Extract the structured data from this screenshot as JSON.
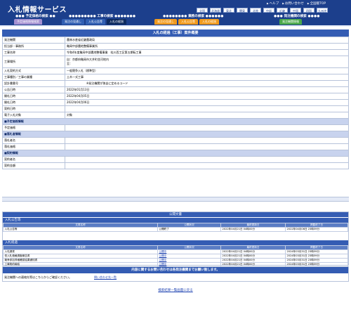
{
  "header": {
    "logo": "入札情報サービス",
    "util": [
      "ヘルプ",
      "お問い合わせ",
      "全国版TOP"
    ],
    "regions": [
      "全国",
      "北海道",
      "東北",
      "関東",
      "北陸",
      "中部",
      "近畿",
      "中国",
      "四国",
      "九州沖縄"
    ],
    "categories": {
      "info": "予定価格の検索",
      "construction": "工事の検索",
      "service": "業務の検索",
      "agency": "発注機関の検索"
    },
    "tabs": [
      "予定価格情報検索",
      "発注の見通し",
      "入札公告等",
      "入札の経過",
      "発注の見通し",
      "入札公告等",
      "入札の経過",
      "発注機関情報"
    ]
  },
  "main": {
    "title": "入札の経過（工事）案件概要",
    "rows": [
      {
        "label": "発注機関",
        "value": "農林水産省近畿農政局"
      },
      {
        "label": "担当部・事務所",
        "value": "亀岡中部農地整備事業所"
      },
      {
        "label": "工事名称",
        "value": "令和4年度亀岡中部農地整備事業　桂川西工区第五期転工事"
      },
      {
        "label": "工事場所",
        "value": "自：京都府亀岡市大井町並河地内",
        "value2": "至："
      },
      {
        "label": "入札契約方式",
        "value": "一般競争入札（標準型）"
      },
      {
        "label": "工事種別／工事の業種",
        "value": "土木一式工事"
      },
      {
        "label": "設計書番号",
        "value": "※発注機関が独自に定めるコード"
      },
      {
        "label": "公告日時",
        "value": "2022年01月13日"
      },
      {
        "label": "開札日時",
        "value": "2022年04月05日"
      },
      {
        "label": "開札日時",
        "value": "2022年04月06日"
      },
      {
        "label": "契約日時",
        "value": ""
      },
      {
        "label": "電子入札対象",
        "value": "対象"
      }
    ],
    "sections": {
      "planned_price": "■予定価格情報",
      "bidder": "■落札者情報",
      "contract": "■契約情報"
    },
    "planned_price_label": "予定価格",
    "bidder_labels": [
      "落札者名",
      "落札価格"
    ],
    "contract_labels": [
      "契約者名",
      "契約金額"
    ]
  },
  "announcements": {
    "title": "公開文書",
    "section1": "入札公告等",
    "section2": "入札経過",
    "headers": [
      "文書名称",
      "公開状況",
      "最終更新日",
      "掲載終了日"
    ],
    "public_rows": [
      {
        "name": "入札公告等",
        "status": "公開終了",
        "updated": "2022年04月21日 04時00分",
        "end": "2022年04月06日 23時59分"
      }
    ],
    "progress_rows": [
      {
        "name": "入札調書",
        "status": "公開中",
        "updated": "2022年04月21日 04時00分",
        "end": "2024年03月31日 23時59分"
      },
      {
        "name": "低入札価格調査報告書",
        "status": "公開中",
        "updated": "2022年04月21日 04時00分",
        "end": "2024年03月31日 23時59分"
      },
      {
        "name": "競争参加資格確認結果通知書",
        "status": "公開中",
        "updated": "2022年04月21日 04時00分",
        "end": "2024年03月31日 23時59分"
      },
      {
        "name": "工事契約締結",
        "status": "公開中",
        "updated": "2022年04月21日 04時00分",
        "end": "2024年03月31日 23時59分"
      }
    ]
  },
  "contact": {
    "title": "内容に関するお問い合わせは各発注機関までお願い致します。",
    "text": "発注機関への連絡先等はこちらからご確認ください。",
    "link": "問い合わせ先一覧"
  },
  "footer": {
    "back_link": "検索結果一覧画面に戻る"
  },
  "colors": {
    "header_bg": "#1c3f8c",
    "section_bar": "#345cb3",
    "section_row": "#c8d3ee",
    "tab_orange": "#f09a1e",
    "tab_green": "#4aa84a",
    "tab_purple": "#a490d1"
  }
}
